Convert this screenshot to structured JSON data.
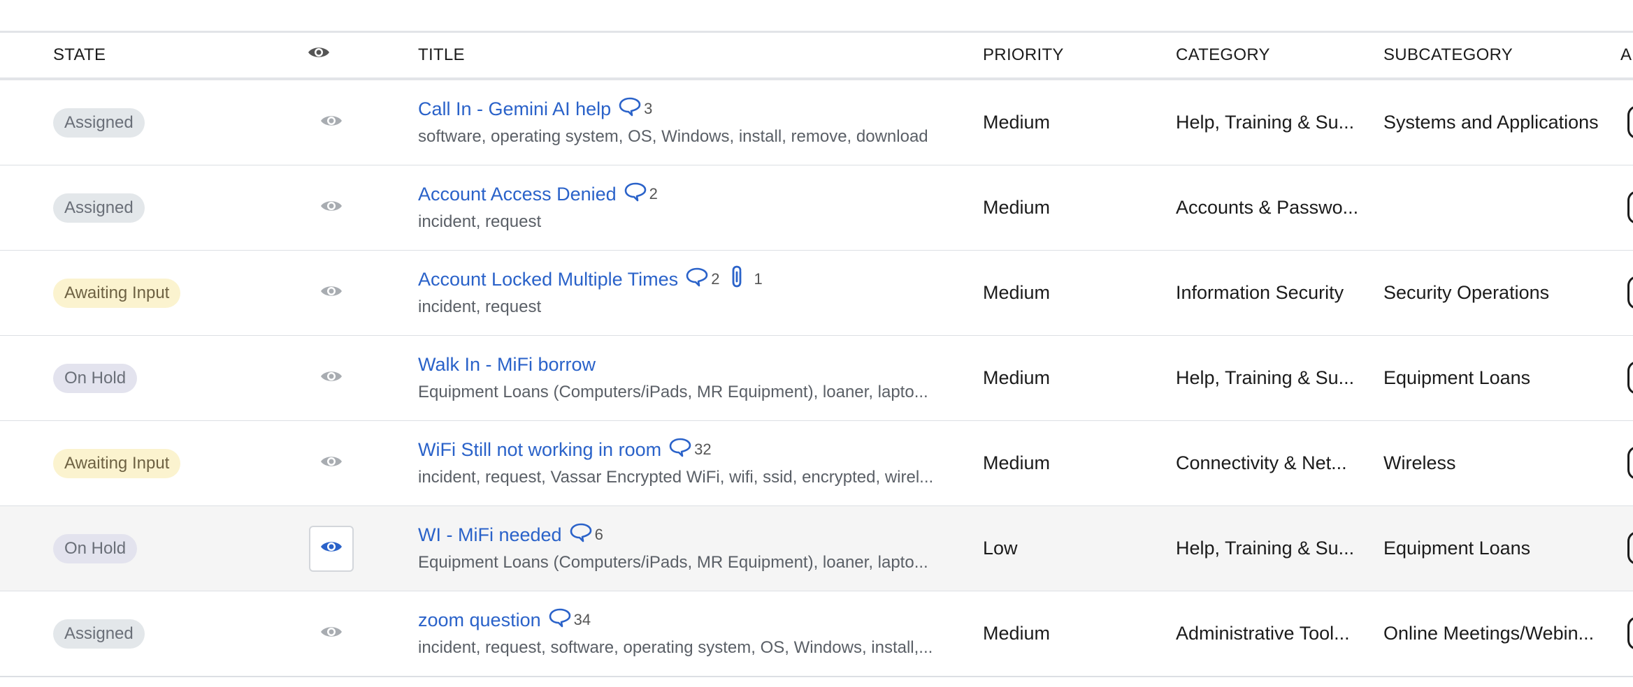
{
  "header": {
    "state": "STATE",
    "title": "TITLE",
    "priority": "PRIORITY",
    "category": "CATEGORY",
    "subcategory": "SUBCATEGORY",
    "next_col": "A"
  },
  "rows": [
    {
      "state": "Assigned",
      "state_kind": "assigned",
      "title": "Call In - Gemini AI help",
      "comments": "3",
      "attachments": "",
      "tags": "software, operating system, OS, Windows, install, remove, download",
      "priority": "Medium",
      "category": "Help, Training & Su...",
      "subcategory": "Systems and Applications"
    },
    {
      "state": "Assigned",
      "state_kind": "assigned",
      "title": "Account Access Denied",
      "comments": "2",
      "attachments": "",
      "tags": "incident, request",
      "priority": "Medium",
      "category": "Accounts & Passwo...",
      "subcategory": ""
    },
    {
      "state": "Awaiting Input",
      "state_kind": "awaiting",
      "title": "Account Locked Multiple Times",
      "comments": "2",
      "attachments": "1",
      "tags": "incident, request",
      "priority": "Medium",
      "category": "Information Security",
      "subcategory": "Security Operations"
    },
    {
      "state": "On Hold",
      "state_kind": "hold",
      "title": "Walk In - MiFi borrow",
      "comments": "",
      "attachments": "",
      "tags": "Equipment Loans (Computers/iPads, MR Equipment), loaner, lapto...",
      "priority": "Medium",
      "category": "Help, Training & Su...",
      "subcategory": "Equipment Loans"
    },
    {
      "state": "Awaiting Input",
      "state_kind": "awaiting",
      "title": "WiFi Still not working in room",
      "comments": "32",
      "attachments": "",
      "tags": "incident, request, Vassar Encrypted WiFi, wifi, ssid, encrypted, wirel...",
      "priority": "Medium",
      "category": "Connectivity & Net...",
      "subcategory": "Wireless"
    },
    {
      "state": "On Hold",
      "state_kind": "hold",
      "title": "WI - MiFi needed",
      "comments": "6",
      "attachments": "",
      "tags": "Equipment Loans (Computers/iPads, MR Equipment), loaner, lapto...",
      "priority": "Low",
      "category": "Help, Training & Su...",
      "subcategory": "Equipment Loans"
    },
    {
      "state": "Assigned",
      "state_kind": "assigned",
      "title": "zoom question",
      "comments": "34",
      "attachments": "",
      "tags": "incident, request, software, operating system, OS, Windows, install,...",
      "priority": "Medium",
      "category": "Administrative Tool...",
      "subcategory": "Online Meetings/Webin..."
    }
  ],
  "colors": {
    "link": "#2a62c9",
    "eye_active": "#2a62c9",
    "eye_inactive": "#a8acb1",
    "badge_assigned": "#e3e7ea",
    "badge_awaiting": "#fbf3cf",
    "badge_hold": "#e3e3ee"
  },
  "icons": {
    "watch": "eye-icon",
    "comments": "comment-bubble-icon",
    "attachments": "paperclip-icon"
  }
}
